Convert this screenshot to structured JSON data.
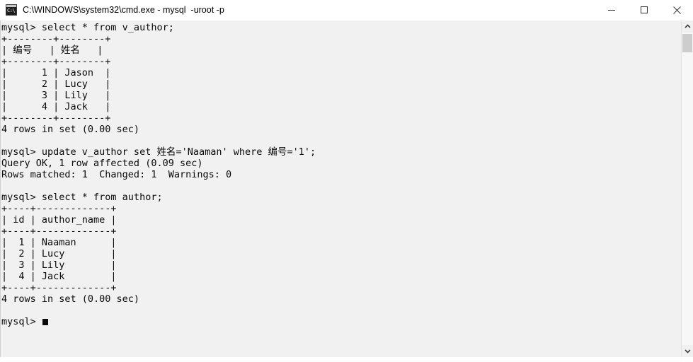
{
  "window": {
    "title": "C:\\WINDOWS\\system32\\cmd.exe - mysql  -uroot -p",
    "icon": "cmd-console-icon",
    "icon_glyph": "C:\\",
    "controls": {
      "minimize_label": "Minimize",
      "maximize_label": "Maximize",
      "close_label": "Close"
    },
    "colors": {
      "titlebar_bg": "#ffffff",
      "console_bg": "#f1f1f1",
      "console_fg": "#0a0a0a",
      "scrollbar_track": "#f7f7f7",
      "scrollbar_thumb": "#cdcdcd"
    }
  },
  "scrollbar": {
    "up_arrow": "scroll-up-arrow",
    "down_arrow": "scroll-down-arrow",
    "thumb_position": "top"
  },
  "console": {
    "prompt": "mysql>",
    "cursor": "block",
    "lines": [
      "mysql> select * from v_author;",
      "+--------+--------+",
      "| 编号   | 姓名   |",
      "+--------+--------+",
      "|      1 | Jason  |",
      "|      2 | Lucy   |",
      "|      3 | Lily   |",
      "|      4 | Jack   |",
      "+--------+--------+",
      "4 rows in set (0.00 sec)",
      "",
      "mysql> update v_author set 姓名='Naaman' where 编号='1';",
      "Query OK, 1 row affected (0.09 sec)",
      "Rows matched: 1  Changed: 1  Warnings: 0",
      "",
      "mysql> select * from author;",
      "+----+-------------+",
      "| id | author_name |",
      "+----+-------------+",
      "|  1 | Naaman      |",
      "|  2 | Lucy        |",
      "|  3 | Lily        |",
      "|  4 | Jack        |",
      "+----+-------------+",
      "4 rows in set (0.00 sec)",
      ""
    ],
    "final_prompt": "mysql> ",
    "commands": [
      "select * from v_author;",
      "update v_author set 姓名='Naaman' where 编号='1';",
      "select * from author;"
    ],
    "tables": [
      {
        "name": "v_author",
        "headers": [
          "编号",
          "姓名"
        ],
        "rows": [
          [
            "1",
            "Jason"
          ],
          [
            "2",
            "Lucy"
          ],
          [
            "3",
            "Lily"
          ],
          [
            "4",
            "Jack"
          ]
        ],
        "footer": "4 rows in set (0.00 sec)"
      },
      {
        "name": "author",
        "headers": [
          "id",
          "author_name"
        ],
        "rows": [
          [
            "1",
            "Naaman"
          ],
          [
            "2",
            "Lucy"
          ],
          [
            "3",
            "Lily"
          ],
          [
            "4",
            "Jack"
          ]
        ],
        "footer": "4 rows in set (0.00 sec)"
      }
    ],
    "status_messages": [
      "Query OK, 1 row affected (0.09 sec)",
      "Rows matched: 1  Changed: 1  Warnings: 0"
    ]
  }
}
